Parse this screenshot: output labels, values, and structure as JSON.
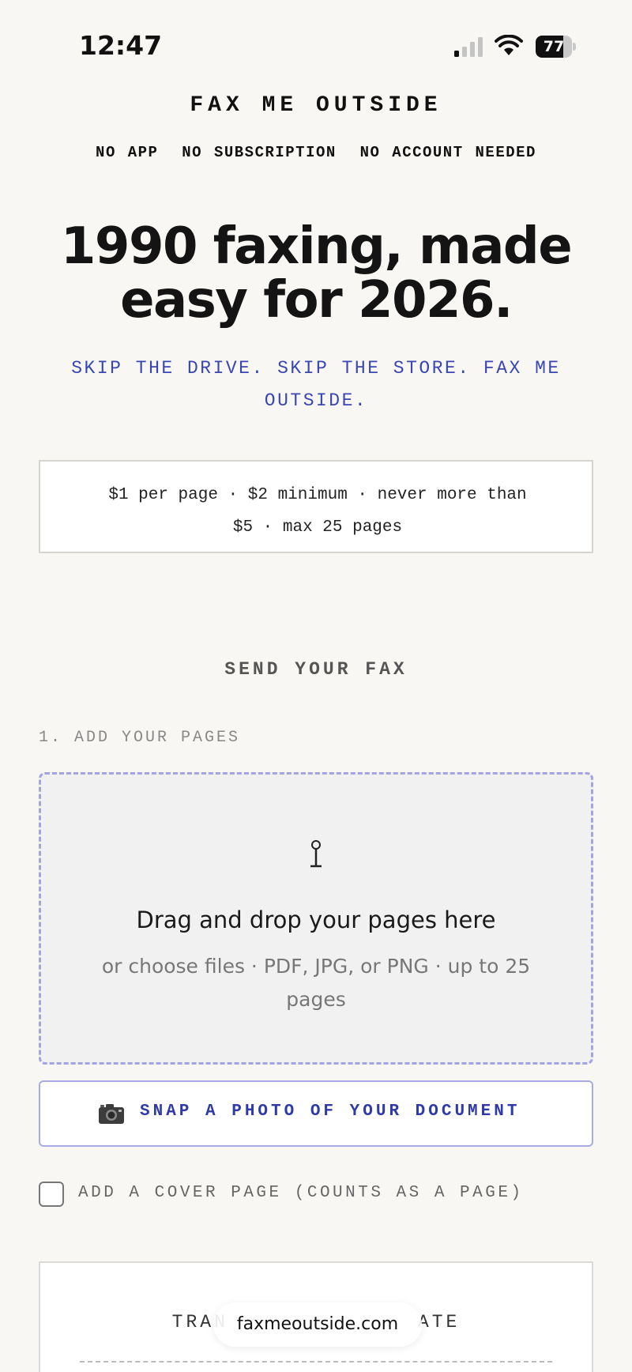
{
  "status_bar": {
    "time": "12:47",
    "battery_level": "77",
    "battery_fraction": 0.77,
    "icons": [
      "signal-icon",
      "wifi-icon",
      "battery-icon"
    ]
  },
  "header": {
    "brand": "FAX ME OUTSIDE",
    "tagline": "NO APP  NO SUBSCRIPTION  NO ACCOUNT NEEDED"
  },
  "hero": {
    "headline_line1": "1990 faxing, made",
    "headline_line2": "easy for 2026.",
    "subhead": "SKIP THE DRIVE. SKIP THE STORE. FAX ME OUTSIDE."
  },
  "pricing": {
    "line1": "$1 per page · $2 minimum · never more than",
    "line2": "$5 · max 25 pages"
  },
  "send_section": {
    "title": "SEND YOUR FAX",
    "step1_label": "1. ADD YOUR PAGES",
    "dropzone": {
      "title": "Drag and drop your pages here",
      "subtitle_line1": "or choose files · PDF, JPG, or PNG · up to 25",
      "subtitle_line2": "pages"
    },
    "photo_button_label": "SNAP A PHOTO OF YOUR DOCUMENT",
    "cover_page_label": "ADD A COVER PAGE (COUNTS AS A PAGE)",
    "cover_page_checked": false
  },
  "estimate": {
    "title_left": "TRAN",
    "title_right": "ATE"
  },
  "browser": {
    "url": "faxmeoutside.com"
  },
  "colors": {
    "background": "#f8f7f4",
    "accent_blue": "#3a47b0",
    "dropzone_border": "#a3a4e0"
  }
}
